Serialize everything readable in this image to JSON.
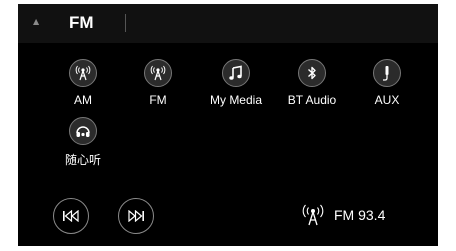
{
  "header": {
    "title": "FM",
    "caret_icon": "caret-up-icon"
  },
  "sources": [
    {
      "label": "AM",
      "icon": "radio-antenna-icon"
    },
    {
      "label": "FM",
      "icon": "radio-antenna-icon"
    },
    {
      "label": "My Media",
      "icon": "music-note-icon"
    },
    {
      "label": "BT Audio",
      "icon": "bluetooth-icon"
    },
    {
      "label": "AUX",
      "icon": "aux-cable-icon"
    },
    {
      "label": "随心听",
      "icon": "headphones-icon"
    }
  ],
  "controls": {
    "previous_icon": "skip-previous-icon",
    "next_icon": "skip-next-icon"
  },
  "now_playing": {
    "icon": "radio-antenna-icon",
    "text": "FM 93.4"
  },
  "colors": {
    "background": "#000000",
    "topbar": "#111111",
    "icon_circle": "#2b2b2b",
    "icon_border": "#777777",
    "text": "#ffffff"
  }
}
